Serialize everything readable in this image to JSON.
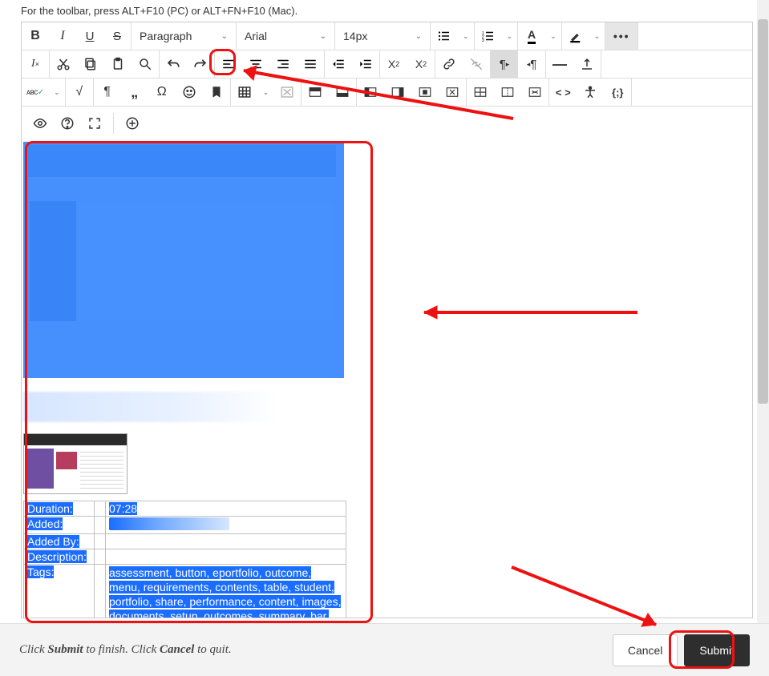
{
  "hint": "For the toolbar, press ALT+F10 (PC) or ALT+FN+F10 (Mac).",
  "selectors": {
    "style": "Paragraph",
    "font": "Arial",
    "size": "14px"
  },
  "meta": {
    "duration_label": "Duration:",
    "duration_value": "07:28",
    "added_label": "Added:",
    "addedby_label": "Added By:",
    "description_label": "Description:",
    "tags_label": "Tags:",
    "tags_value": "assessment, button, eportfolio, outcome, menu, requirements, contents, table, student, portfolio, share, performance, content, images, documents, setup, outcomes, summary, bar,"
  },
  "footer": {
    "text_prefix": "Click ",
    "submit_word": "Submit",
    "text_mid": " to finish. Click ",
    "cancel_word": "Cancel",
    "text_suffix": " to quit.",
    "cancel_btn": "Cancel",
    "submit_btn": "Submit"
  }
}
